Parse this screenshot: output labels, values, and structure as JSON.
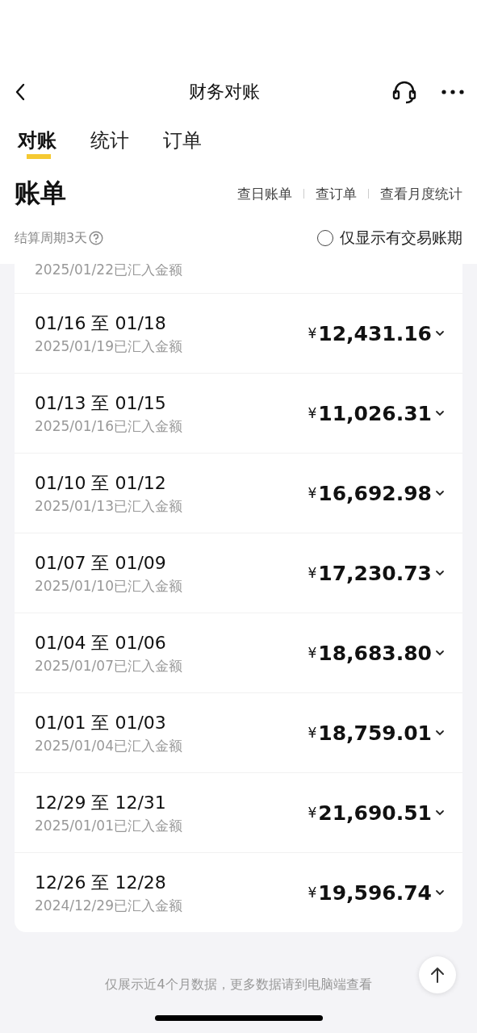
{
  "nav": {
    "title": "财务对账"
  },
  "tabs": [
    {
      "label": "对账",
      "selected": true
    },
    {
      "label": "统计",
      "selected": false
    },
    {
      "label": "订单",
      "selected": false
    }
  ],
  "section": {
    "title": "账单",
    "links": [
      "查日账单",
      "查订单",
      "查看月度统计"
    ]
  },
  "filter": {
    "cycle": "结算周期3天",
    "option": "仅显示有交易账期",
    "checked": false
  },
  "partial_row": {
    "subtitle": "2025/01/22已汇入金额"
  },
  "rows": [
    {
      "period": "01/16 至 01/18",
      "subtitle": "2025/01/19已汇入金额",
      "currency": "¥",
      "amount": "12,431.16"
    },
    {
      "period": "01/13 至 01/15",
      "subtitle": "2025/01/16已汇入金额",
      "currency": "¥",
      "amount": "11,026.31"
    },
    {
      "period": "01/10 至 01/12",
      "subtitle": "2025/01/13已汇入金额",
      "currency": "¥",
      "amount": "16,692.98"
    },
    {
      "period": "01/07 至 01/09",
      "subtitle": "2025/01/10已汇入金额",
      "currency": "¥",
      "amount": "17,230.73"
    },
    {
      "period": "01/04 至 01/06",
      "subtitle": "2025/01/07已汇入金额",
      "currency": "¥",
      "amount": "18,683.80"
    },
    {
      "period": "01/01 至 01/03",
      "subtitle": "2025/01/04已汇入金额",
      "currency": "¥",
      "amount": "18,759.01"
    },
    {
      "period": "12/29 至 12/31",
      "subtitle": "2025/01/01已汇入金额",
      "currency": "¥",
      "amount": "21,690.51"
    },
    {
      "period": "12/26 至 12/28",
      "subtitle": "2024/12/29已汇入金额",
      "currency": "¥",
      "amount": "19,596.74"
    }
  ],
  "footer": {
    "note": "仅展示近4个月数据，更多数据请到电脑端查看"
  }
}
